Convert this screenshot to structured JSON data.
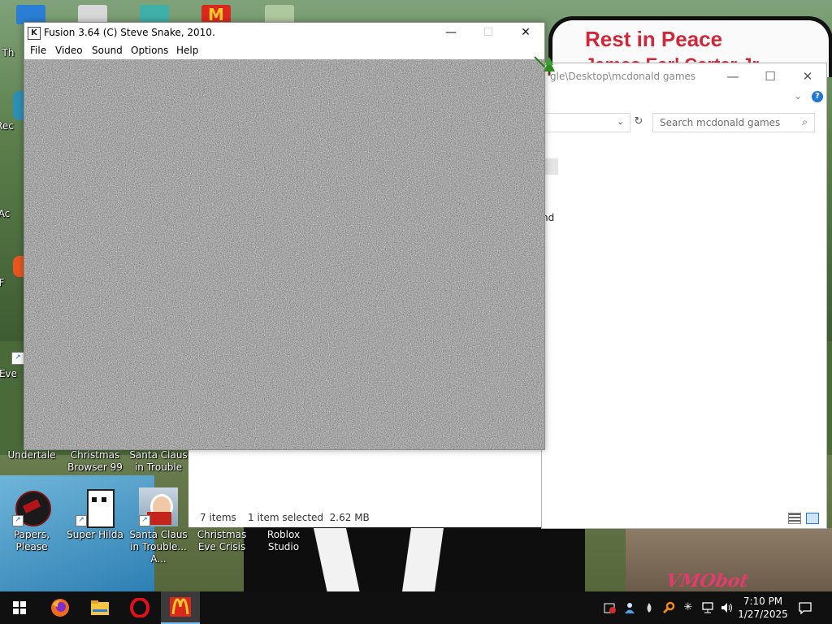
{
  "wallpaper": {
    "memorial_line1": "Rest in Peace",
    "memorial_line2": "James Earl Carter Jr.",
    "watermark": "VMObot"
  },
  "desktop": {
    "left_fragments": [
      "Th",
      "Rec",
      "Ac",
      "F",
      "Eve"
    ],
    "row1": [
      {
        "label": "Undertale"
      },
      {
        "label": "Christmas Browser 99"
      },
      {
        "label": "Santa Claus in Trouble"
      }
    ],
    "row2": [
      {
        "label": "Papers, Please"
      },
      {
        "label": "Super Hilda"
      },
      {
        "label": "Santa Claus in Trouble... A..."
      },
      {
        "label": "Christmas Eve Crisis"
      },
      {
        "label": "Roblox Studio"
      }
    ]
  },
  "fusion": {
    "title": "Fusion 3.64 (C) Steve Snake, 2010.",
    "icon_letter": "K",
    "menu": [
      "File",
      "Video",
      "Sound",
      "Options",
      "Help"
    ],
    "controls": {
      "minimize": "—",
      "maximize": "☐",
      "close": "✕"
    }
  },
  "explorer": {
    "path": "gle\\Desktop\\mcdonald games",
    "search_placeholder": "Search mcdonald games",
    "file_fragment": "nd",
    "status_items": "7 items",
    "status_selected": "1 item selected  2.62 MB",
    "controls": {
      "minimize": "—",
      "maximize": "☐",
      "close": "✕"
    },
    "help": "?"
  },
  "taskbar": {
    "apps": [
      {
        "name": "start",
        "icon": "windows-logo"
      },
      {
        "name": "firefox",
        "icon": "firefox-icon"
      },
      {
        "name": "file-explorer",
        "icon": "folder-icon"
      },
      {
        "name": "opera",
        "icon": "opera-icon"
      },
      {
        "name": "mcdonalds",
        "icon": "mcdonalds-icon",
        "active": true
      }
    ],
    "clock_time": "7:10 PM",
    "clock_date": "1/27/2025"
  },
  "colors": {
    "accent": "#76b9ed",
    "memorial_red": "#d0283a",
    "mcdonalds_red": "#da291c",
    "mcdonalds_yellow": "#ffc72c"
  }
}
